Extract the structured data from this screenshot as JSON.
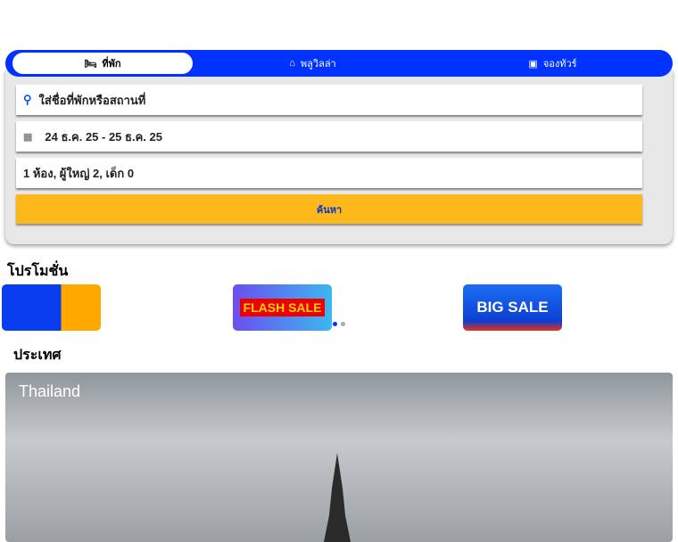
{
  "tabs": [
    {
      "label": "ที่พัก",
      "icon": "bed-icon"
    },
    {
      "label": "พลูวิลล่า",
      "icon": "home-icon"
    },
    {
      "label": "จองทัวร์",
      "icon": "luggage-icon"
    }
  ],
  "search": {
    "placeholder": "ใส่ชื่อที่พักหรือสถานที่",
    "dates": "24 ธ.ค. 25 - 25 ธ.ค. 25",
    "guests": "1 ห้อง, ผู้ใหญ่ 2, เด็ก 0",
    "button": "ค้นหา"
  },
  "promotions": {
    "title": "โปรโมชั่น",
    "items": [
      "",
      "FLASH SALE",
      "BIG SALE"
    ]
  },
  "country": {
    "title": "ประเทศ",
    "name": "Thailand"
  },
  "colors": {
    "accent": "#0033ff",
    "button": "#ffb81c"
  }
}
